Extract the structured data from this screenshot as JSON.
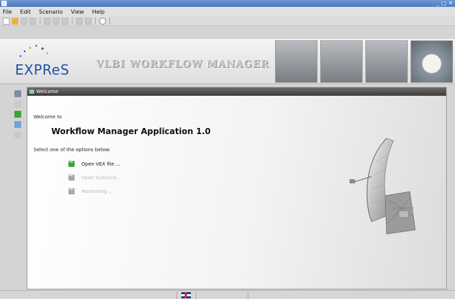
{
  "window": {
    "title": "",
    "controls": [
      "_",
      "□",
      "✕"
    ]
  },
  "menu": [
    "File",
    "Edit",
    "Scenario",
    "View",
    "Help"
  ],
  "toolbar": {
    "icons": [
      "new-file-icon",
      "open-folder-icon",
      "save-icon",
      "save-all-icon",
      "copy-icon",
      "paste-icon",
      "delete-icon",
      "undo-icon",
      "redo-icon",
      "refresh-icon"
    ]
  },
  "banner": {
    "logo": "EXPReS",
    "title": "VLBI WORKFLOW MANAGER",
    "photos": [
      "radio-telescope-photo",
      "radio-telescope-photo",
      "radio-telescope-photo",
      "radome-photo"
    ]
  },
  "tab": {
    "label": "Welcome"
  },
  "welcome": {
    "intro": "Welcome to",
    "app_name": "Workflow Manager Application 1.0",
    "prompt": "Select one of the options below:",
    "options": [
      {
        "label": "Open VEX file ...",
        "enabled": true
      },
      {
        "label": "Open Scenario ...",
        "enabled": false
      },
      {
        "label": "Monitoring ...",
        "enabled": false
      }
    ]
  },
  "colors": {
    "accent": "#1d54a4",
    "enabled_icon": "#3ba43b",
    "disabled_text": "#b9b9b9"
  }
}
